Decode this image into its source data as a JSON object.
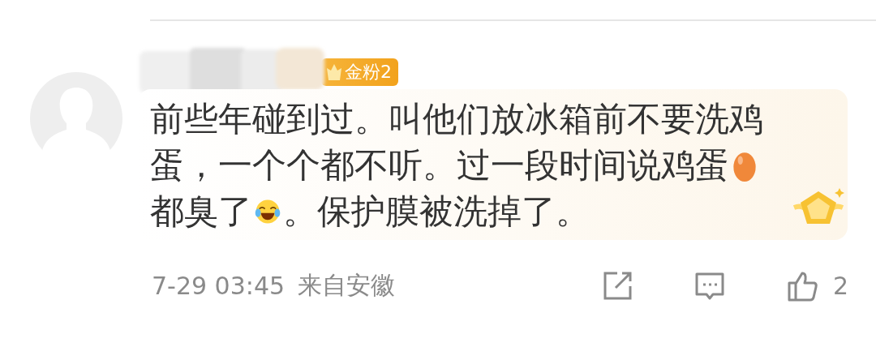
{
  "comment": {
    "badge": {
      "label": "金粉2"
    },
    "lines": [
      [
        {
          "kind": "text",
          "text": "前些年碰到过。叫他们放冰箱前不要洗鸡"
        }
      ],
      [
        {
          "kind": "text",
          "text": "蛋，一个个都不听。过一段时间说鸡蛋"
        },
        {
          "kind": "egg_emoji"
        }
      ],
      [
        {
          "kind": "text",
          "text": "都臭了"
        },
        {
          "kind": "laugh_emoji"
        },
        {
          "kind": "text",
          "text": "。保护膜被洗掉了。"
        }
      ]
    ],
    "date": "7-29 03:45",
    "location": "来自安徽",
    "likes": "2"
  }
}
